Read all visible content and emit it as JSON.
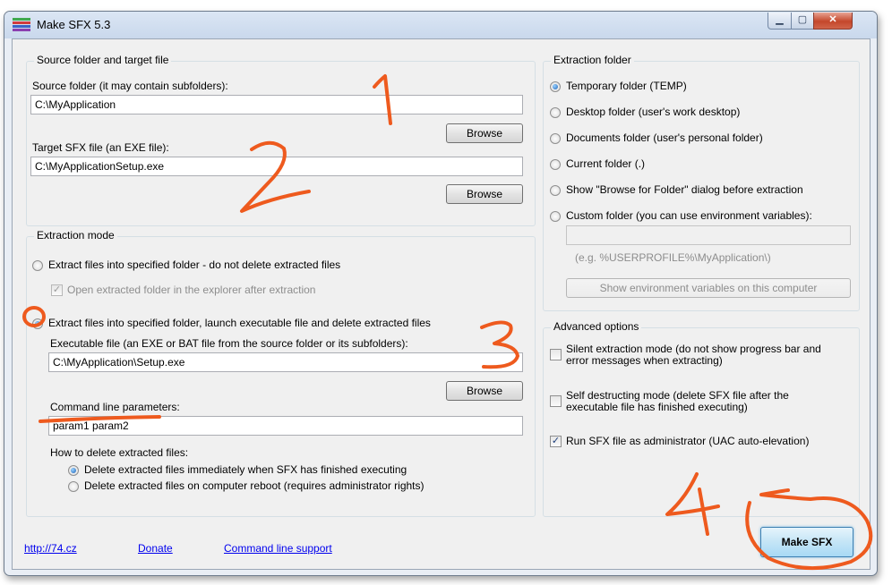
{
  "window": {
    "title": "Make SFX 5.3",
    "controls": {
      "minimize": "▁",
      "maximize": "▢",
      "close": "✕"
    }
  },
  "source": {
    "group_label": "Source folder and target file",
    "source_label": "Source folder (it may contain subfolders):",
    "source_value": "C:\\MyApplication",
    "target_label": "Target SFX file (an EXE file):",
    "target_value": "C:\\MyApplicationSetup.exe",
    "browse": "Browse"
  },
  "mode": {
    "group_label": "Extraction mode",
    "opt1": "Extract files into specified folder - do not delete extracted files",
    "open_explorer": "Open extracted folder in the explorer after extraction",
    "opt2": "Extract files into specified folder, launch executable file and delete extracted files",
    "exe_label": "Executable file (an EXE or BAT file from the source folder or its subfolders):",
    "exe_value": "C:\\MyApplication\\Setup.exe",
    "browse": "Browse",
    "params_label": "Command line parameters:",
    "params_value": "param1 param2",
    "delete_label": "How to delete extracted files:",
    "delete_opt1": "Delete extracted files immediately when SFX has finished executing",
    "delete_opt2": "Delete extracted files on computer reboot (requires administrator rights)"
  },
  "extraction": {
    "group_label": "Extraction folder",
    "options": [
      "Temporary folder (TEMP)",
      "Desktop folder (user's work desktop)",
      "Documents folder (user's personal folder)",
      "Current folder (.)",
      "Show \"Browse for Folder\" dialog before extraction",
      "Custom folder (you can use environment variables):"
    ],
    "custom_value": "",
    "example": "(e.g. %USERPROFILE%\\MyApplication\\)",
    "env_button": "Show environment variables on this computer"
  },
  "advanced": {
    "group_label": "Advanced options",
    "silent_line1": "Silent extraction mode (do not show progress bar and",
    "silent_line2": "error messages when extracting)",
    "selfdestruct_line1": "Self destructing mode (delete SFX file after the",
    "selfdestruct_line2": "executable file has finished executing)",
    "admin": "Run SFX file as administrator (UAC auto-elevation)"
  },
  "footer": {
    "link_site": "http://74.cz",
    "link_donate": "Donate",
    "link_cmd": "Command line support",
    "make": "Make SFX"
  },
  "annotations": {
    "n1": "1",
    "n2": "2",
    "n3": "3",
    "n4": "4",
    "color": "#ee5a1e"
  }
}
